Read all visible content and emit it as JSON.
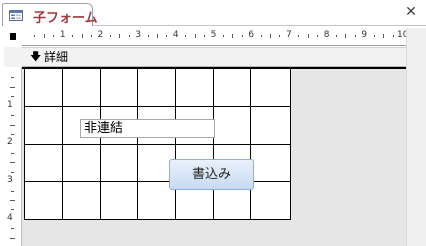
{
  "tab": {
    "title": "子フォーム",
    "icon": "form-icon",
    "close_icon": "close-icon",
    "close_glyph": "✕"
  },
  "section": {
    "arrow_icon": "arrow-down-icon",
    "arrow_glyph": "🡇",
    "label": "詳細"
  },
  "hruler": {
    "numbers": [
      "1",
      "2",
      "3",
      "4",
      "5",
      "6",
      "7",
      "8",
      "9",
      "10"
    ]
  },
  "vruler": {
    "numbers": [
      "1",
      "2",
      "3",
      "4"
    ]
  },
  "controls": {
    "label_text": "非連結",
    "write_button_label": "書込み"
  },
  "colors": {
    "tab_title": "#a4373a",
    "button_top": "#eaf2fb",
    "button_bottom": "#c6daf2",
    "canvas_bg": "#e6e6e6"
  }
}
